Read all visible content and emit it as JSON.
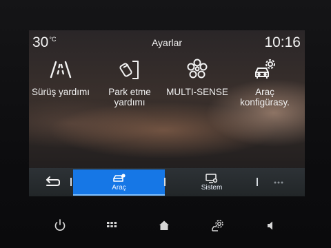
{
  "status": {
    "temperature": "30",
    "temperature_unit": "°C",
    "title": "Ayarlar",
    "time": "10:16"
  },
  "tiles": [
    {
      "icon": "lane-assist-icon",
      "label": "Sürüş yardımı"
    },
    {
      "icon": "parking-icon",
      "label": "Park etme yardımı"
    },
    {
      "icon": "multi-sense-icon",
      "label": "MULTI-SENSE"
    },
    {
      "icon": "car-gear-icon",
      "label": "Araç konfigürasy."
    }
  ],
  "tabs": [
    {
      "icon": "car-tab-icon",
      "label": "Araç",
      "active": true
    },
    {
      "icon": "system-tab-icon",
      "label": "Sistem",
      "active": false
    }
  ],
  "nav": {
    "back_icon": "back-arrow-icon",
    "more_icon": "more-dots-icon"
  },
  "bottom_buttons": [
    "power-icon",
    "apps-grid-icon",
    "home-icon",
    "car-settings-icon",
    "volume-icon"
  ],
  "colors": {
    "accent": "#1677e6",
    "tab_bar": "#2a2f33"
  }
}
